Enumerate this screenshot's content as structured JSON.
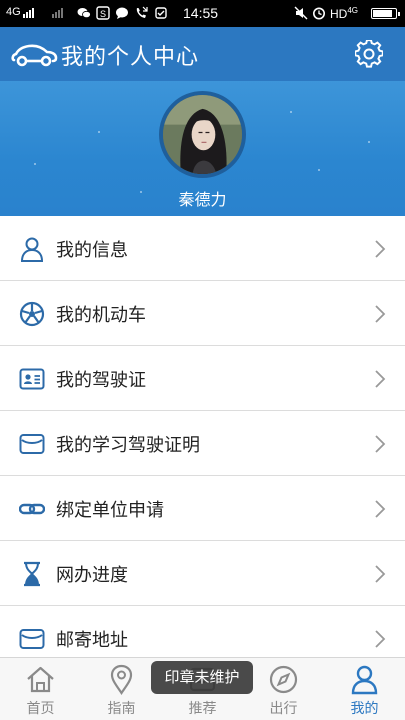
{
  "status_bar": {
    "network_left": "4G",
    "network_right": "HD",
    "network_right_sub": "4G",
    "time": "14:55",
    "battery_level": 0.85,
    "icons": [
      "signal-icon",
      "wechat-icon",
      "s-app-icon",
      "message-icon",
      "missed-call-icon",
      "notification-icon",
      "mute-icon",
      "alarm-icon",
      "battery-icon"
    ]
  },
  "header": {
    "title": "我的个人中心",
    "logo_icon": "car-logo-icon",
    "settings_icon": "gear-icon"
  },
  "profile": {
    "username": "秦德力",
    "avatar": "user-avatar"
  },
  "menu": {
    "items": [
      {
        "label": "我的信息",
        "icon": "user-icon"
      },
      {
        "label": "我的机动车",
        "icon": "steering-wheel-icon"
      },
      {
        "label": "我的驾驶证",
        "icon": "id-card-icon"
      },
      {
        "label": "我的学习驾驶证明",
        "icon": "envelope-icon"
      },
      {
        "label": "绑定单位申请",
        "icon": "link-icon"
      },
      {
        "label": "网办进度",
        "icon": "hourglass-icon"
      },
      {
        "label": "邮寄地址",
        "icon": "envelope-icon"
      }
    ]
  },
  "bottom_nav": {
    "items": [
      {
        "label": "首页",
        "icon": "home-icon",
        "active": false
      },
      {
        "label": "指南",
        "icon": "location-pin-icon",
        "active": false
      },
      {
        "label": "推荐",
        "icon": "recommend-icon",
        "active": false
      },
      {
        "label": "出行",
        "icon": "compass-icon",
        "active": false
      },
      {
        "label": "我的",
        "icon": "user-icon",
        "active": true
      }
    ]
  },
  "toast": {
    "text": "印章未维护"
  },
  "colors": {
    "primary": "#2c78c1",
    "banner": "#2b86d0",
    "icon": "#2c6aa8",
    "inactive": "#8a8a8a"
  }
}
